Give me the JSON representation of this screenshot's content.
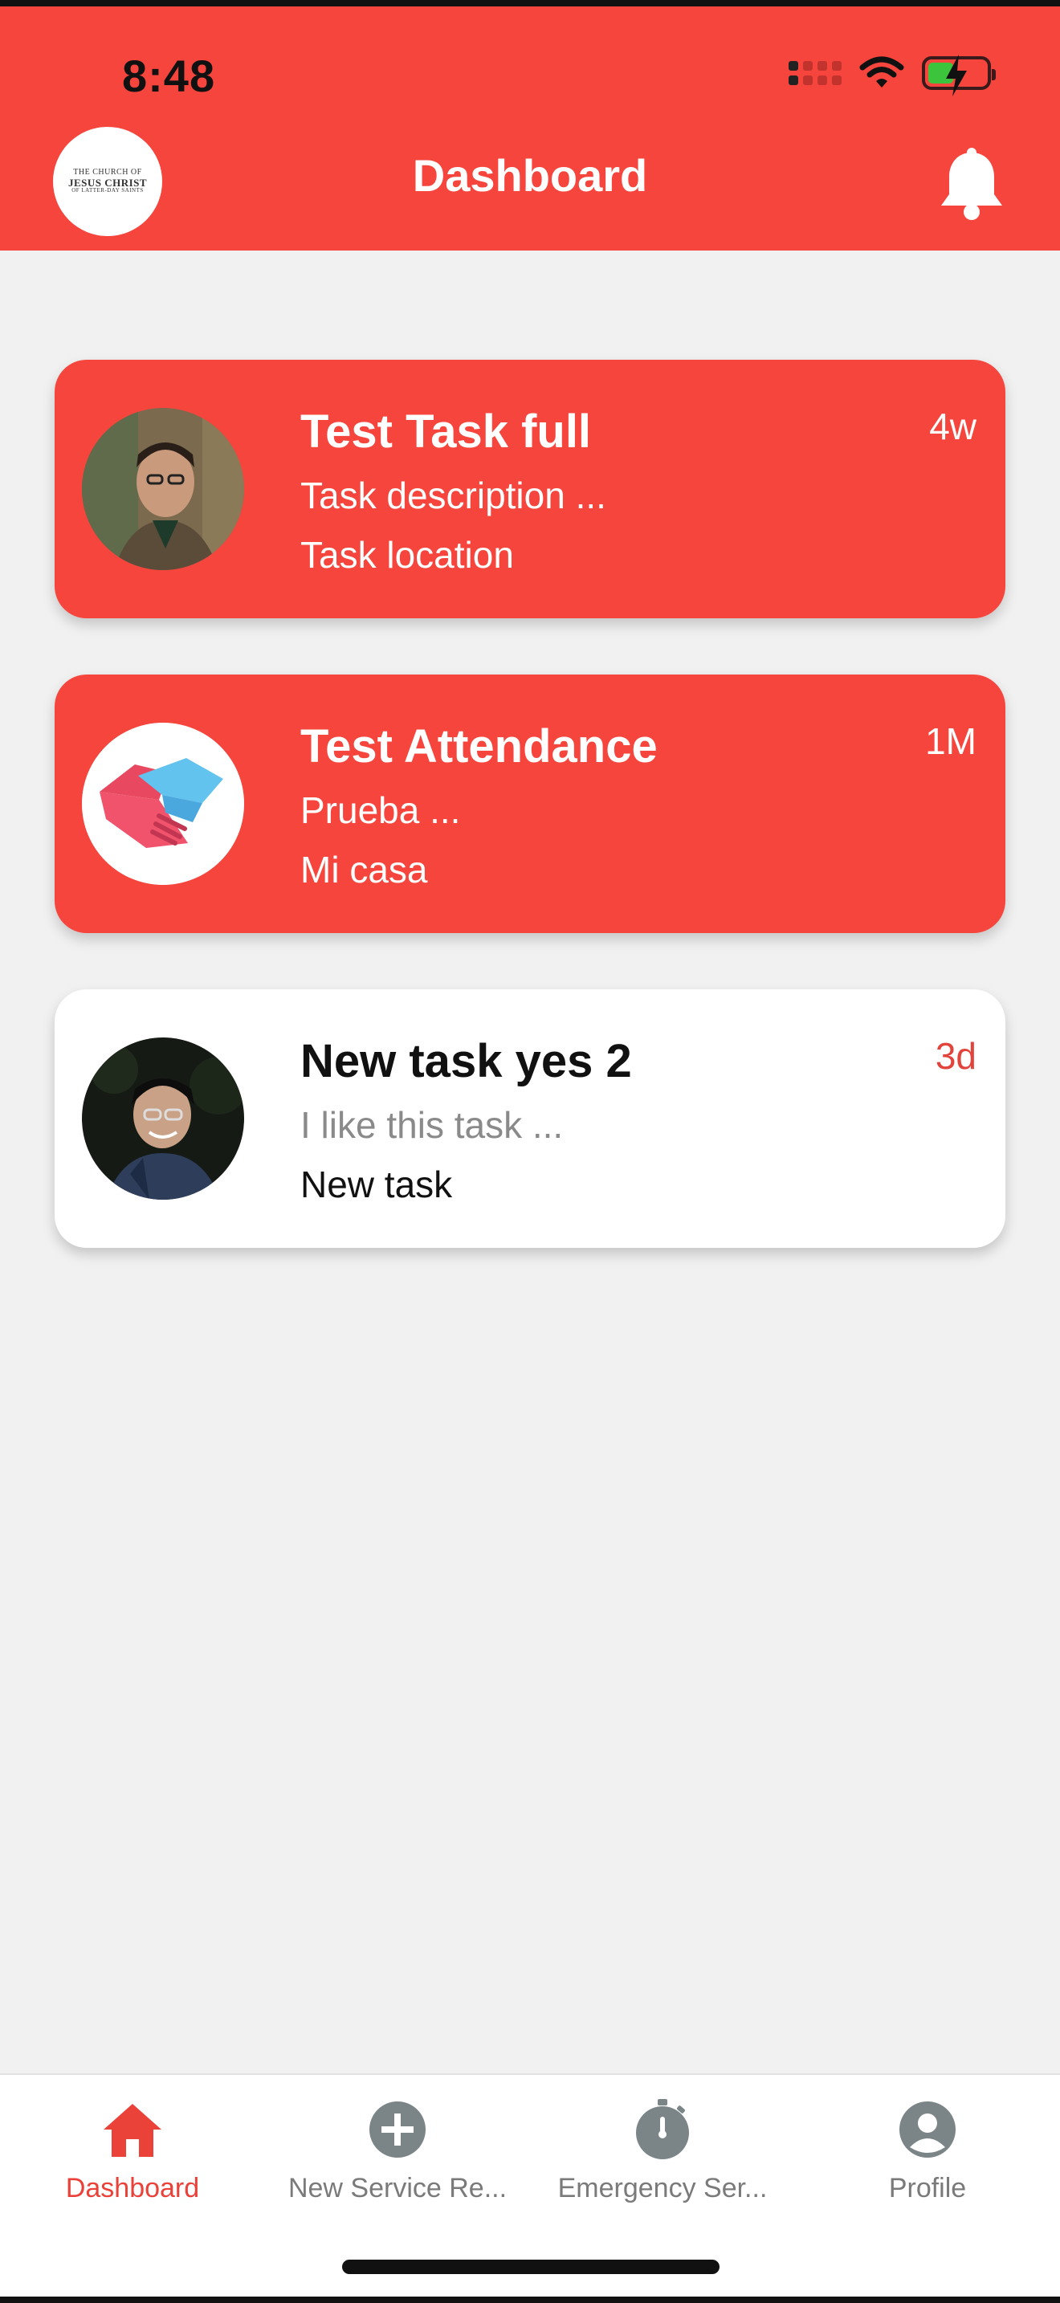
{
  "status_bar": {
    "time": "8:48"
  },
  "header": {
    "title": "Dashboard",
    "logo": {
      "line1": "THE CHURCH OF",
      "line2": "JESUS CHRIST",
      "line3": "OF LATTER-DAY SAINTS"
    },
    "accent_color": "#f6453d"
  },
  "tasks": [
    {
      "title": "Test Task full",
      "description": "Task description ...",
      "location": "Task location",
      "age": "4w",
      "style": "red",
      "avatar": "person-photo"
    },
    {
      "title": "Test Attendance",
      "description": "Prueba ...",
      "location": "Mi casa",
      "age": "1M",
      "style": "red",
      "avatar": "handshake-icon"
    },
    {
      "title": "New task yes 2",
      "description": "I like this task ...",
      "location": "New task",
      "age": "3d",
      "style": "white",
      "avatar": "person-photo"
    }
  ],
  "bottom_nav": {
    "items": [
      {
        "label": "Dashboard",
        "icon": "home-icon",
        "active": true
      },
      {
        "label": "New Service Re...",
        "icon": "plus-circle-icon",
        "active": false
      },
      {
        "label": "Emergency Ser...",
        "icon": "stopwatch-icon",
        "active": false
      },
      {
        "label": "Profile",
        "icon": "profile-icon",
        "active": false
      }
    ]
  }
}
